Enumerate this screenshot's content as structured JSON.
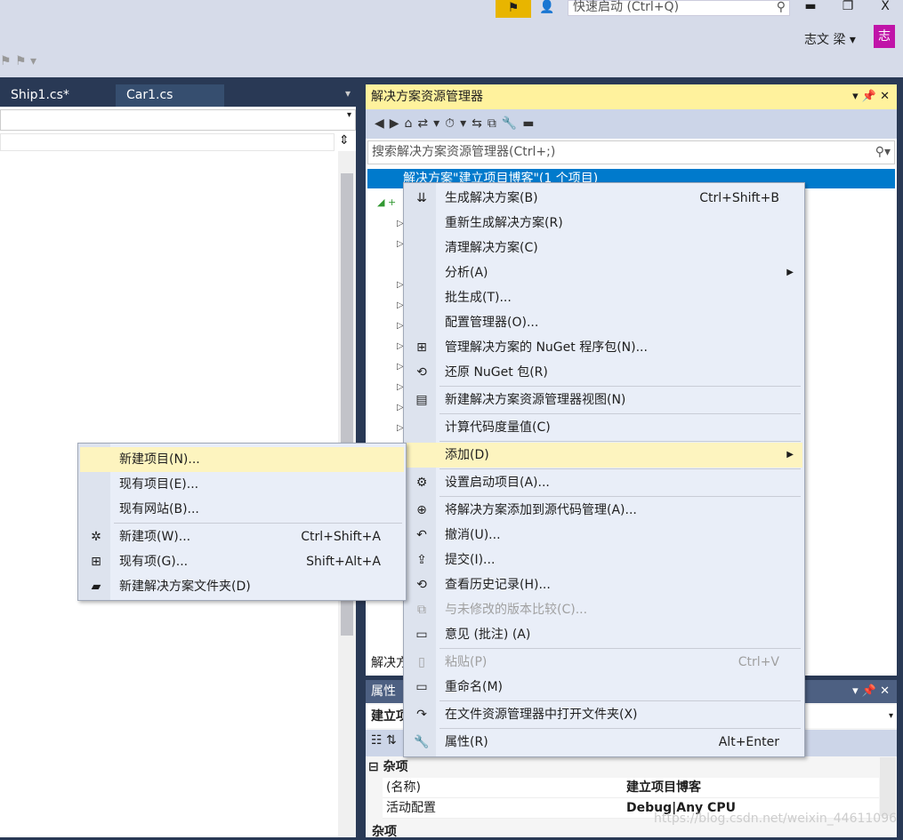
{
  "titlebar": {
    "quick_launch_placeholder": "快速启动 (Ctrl+Q)",
    "user_name": "志文 梁",
    "avatar_letter": "志",
    "feedback_icon": "flag-icon",
    "minimize": "▬",
    "restore": "❐",
    "close": "X"
  },
  "tabs": [
    {
      "label": "Ship1.cs*"
    },
    {
      "label": "Car1.cs"
    }
  ],
  "solution_explorer": {
    "title": "解决方案资源管理器",
    "search_placeholder": "搜索解决方案资源管理器(Ctrl+;)",
    "selected_item": "解决方案\"建立项目博客\"(1 个项目)",
    "footer_tab": "解决方"
  },
  "properties": {
    "title": "属性",
    "selected_object": "建立项",
    "category": "杂项",
    "rows": [
      {
        "name": "(名称)",
        "value": "建立项目博客"
      },
      {
        "name": "活动配置",
        "value": "Debug|Any CPU"
      }
    ],
    "footer": "杂项"
  },
  "context_menu": [
    {
      "icon": "build-icon",
      "glyph": "⇊",
      "label": "生成解决方案(B)",
      "shortcut": "Ctrl+Shift+B"
    },
    {
      "label": "重新生成解决方案(R)"
    },
    {
      "label": "清理解决方案(C)"
    },
    {
      "label": "分析(A)",
      "submenu": true
    },
    {
      "label": "批生成(T)..."
    },
    {
      "label": "配置管理器(O)..."
    },
    {
      "icon": "nuget-icon",
      "glyph": "⊞",
      "label": "管理解决方案的 NuGet 程序包(N)..."
    },
    {
      "icon": "restore-icon",
      "glyph": "⟲",
      "label": "还原 NuGet 包(R)",
      "sep_after": true
    },
    {
      "icon": "new-view-icon",
      "glyph": "▤",
      "label": "新建解决方案资源管理器视图(N)",
      "sep_after": true
    },
    {
      "label": "计算代码度量值(C)",
      "sep_after": true
    },
    {
      "label": "添加(D)",
      "submenu": true,
      "highlighted": true,
      "sep_after": true
    },
    {
      "icon": "gear-icon",
      "glyph": "⚙",
      "label": "设置启动项目(A)...",
      "sep_after": true
    },
    {
      "icon": "source-control-icon",
      "glyph": "⊕",
      "label": "将解决方案添加到源代码管理(A)..."
    },
    {
      "icon": "undo-icon",
      "glyph": "↶",
      "label": "撤消(U)..."
    },
    {
      "icon": "commit-icon",
      "glyph": "⇪",
      "label": "提交(I)..."
    },
    {
      "icon": "history-icon",
      "glyph": "⟲",
      "label": "查看历史记录(H)..."
    },
    {
      "icon": "compare-icon",
      "glyph": "⧉",
      "label": "与未修改的版本比较(C)...",
      "disabled": true
    },
    {
      "icon": "comment-icon",
      "glyph": "▭",
      "label": "意见 (批注) (A)",
      "sep_after": true
    },
    {
      "icon": "paste-icon",
      "glyph": "▯",
      "label": "粘贴(P)",
      "shortcut": "Ctrl+V",
      "disabled": true
    },
    {
      "icon": "rename-icon",
      "glyph": "▭",
      "label": "重命名(M)",
      "sep_after": true
    },
    {
      "icon": "open-folder-icon",
      "glyph": "↷",
      "label": "在文件资源管理器中打开文件夹(X)",
      "sep_after": true
    },
    {
      "icon": "wrench-icon",
      "glyph": "🔧",
      "label": "属性(R)",
      "shortcut": "Alt+Enter"
    }
  ],
  "add_submenu": [
    {
      "label": "新建项目(N)...",
      "highlighted": true
    },
    {
      "label": "现有项目(E)..."
    },
    {
      "label": "现有网站(B)...",
      "sep_after": true
    },
    {
      "icon": "new-item-icon",
      "glyph": "✲",
      "label": "新建项(W)...",
      "shortcut": "Ctrl+Shift+A"
    },
    {
      "icon": "existing-item-icon",
      "glyph": "⊞",
      "label": "现有项(G)...",
      "shortcut": "Shift+Alt+A"
    },
    {
      "icon": "new-folder-icon",
      "glyph": "▰",
      "label": "新建解决方案文件夹(D)"
    }
  ],
  "watermark": "https://blog.csdn.net/weixin_44611096"
}
